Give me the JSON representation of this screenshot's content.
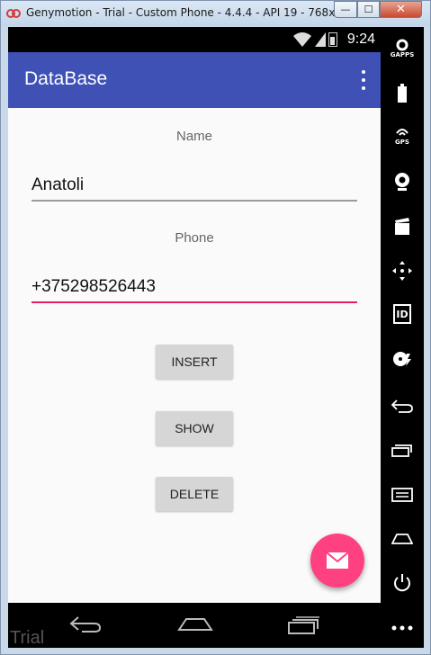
{
  "window": {
    "title": "Genymotion - Trial - Custom Phone - 4.4.4 - API 19 - 768x128...",
    "minimize_glyph": "—",
    "maximize_glyph": "☐",
    "close_glyph": "✕"
  },
  "statusbar": {
    "time": "9:24"
  },
  "app": {
    "title": "DataBase"
  },
  "form": {
    "name_label": "Name",
    "name_value": "Anatoli",
    "phone_label": "Phone",
    "phone_value": "+375298526443",
    "insert_label": "INSERT",
    "show_label": "SHOW",
    "delete_label": "DELETE"
  },
  "navbar": {
    "watermark": "Trial"
  },
  "sidebar": {
    "gapps_label": "GAPPS",
    "gps_label": "GPS",
    "id_label": "ID"
  },
  "colors": {
    "primary": "#3f51b5",
    "accent": "#ff4081",
    "active_underline": "#e91e63"
  }
}
